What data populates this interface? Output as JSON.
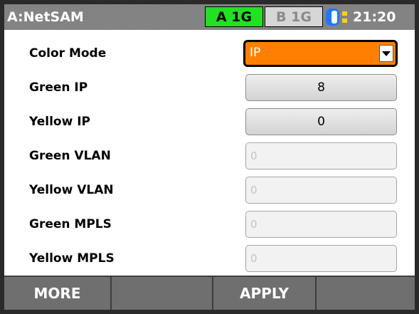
{
  "header": {
    "title": "A:NetSAM",
    "port_a": "A 1G",
    "port_b": "B 1G",
    "time": "21:20",
    "status_icon": "connector-status-icon",
    "colors": {
      "port_a_active": "#22e022",
      "port_b_inactive": "#d6d6d6",
      "status_icon_blue": "#1e78ff",
      "status_icon_yellow": "#ffd400"
    }
  },
  "settings": [
    {
      "label": "Color Mode",
      "type": "select",
      "value": "IP"
    },
    {
      "label": "Green IP",
      "type": "button",
      "value": "8"
    },
    {
      "label": "Yellow IP",
      "type": "button",
      "value": "0"
    },
    {
      "label": "Green VLAN",
      "type": "disabled",
      "value": "0"
    },
    {
      "label": "Yellow VLAN",
      "type": "disabled",
      "value": "0"
    },
    {
      "label": "Green MPLS",
      "type": "disabled",
      "value": "0"
    },
    {
      "label": "Yellow MPLS",
      "type": "disabled",
      "value": "0"
    }
  ],
  "softkeys": [
    "MORE",
    "",
    "APPLY",
    ""
  ],
  "colors": {
    "select_accent": "#ff8000"
  }
}
